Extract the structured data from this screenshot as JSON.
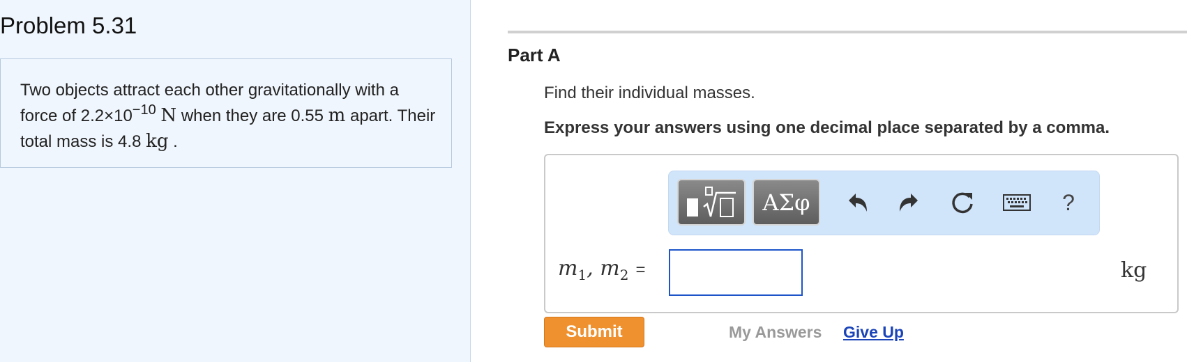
{
  "problem": {
    "title": "Problem 5.31",
    "text_part1": "Two objects attract each other gravitationally with a force of ",
    "force_value": "2.2×10",
    "force_exponent": "−10",
    "force_unit": "N",
    "text_part2": " when they are ",
    "distance_value": "0.55",
    "distance_unit": "m",
    "text_part3": " apart. Their total mass is ",
    "mass_value": "4.8",
    "mass_unit": "kg",
    "text_part4": " ."
  },
  "part": {
    "title": "Part A",
    "instruction": "Find their individual masses.",
    "instruction_bold": "Express your answers using one decimal place separated by a comma."
  },
  "toolbar": {
    "symbols_label": "ΑΣφ",
    "help_label": "?",
    "icons": [
      "templates-icon",
      "undo-icon",
      "redo-icon",
      "reset-icon",
      "keyboard-icon",
      "help-icon"
    ]
  },
  "answer": {
    "var1": "m",
    "var1_sub": "1",
    "separator": ", ",
    "var2": "m",
    "var2_sub": "2",
    "equals": "=",
    "input_value": "",
    "unit": "kg"
  },
  "actions": {
    "submit_label": "Submit",
    "my_answers_label": "My Answers",
    "give_up_label": "Give Up"
  },
  "colors": {
    "left_panel_bg": "#f0f6fd",
    "toolbar_bg": "#d0e4fa",
    "submit_bg": "#f0912f",
    "input_border": "#1d55c9",
    "link": "#1a44b8"
  }
}
